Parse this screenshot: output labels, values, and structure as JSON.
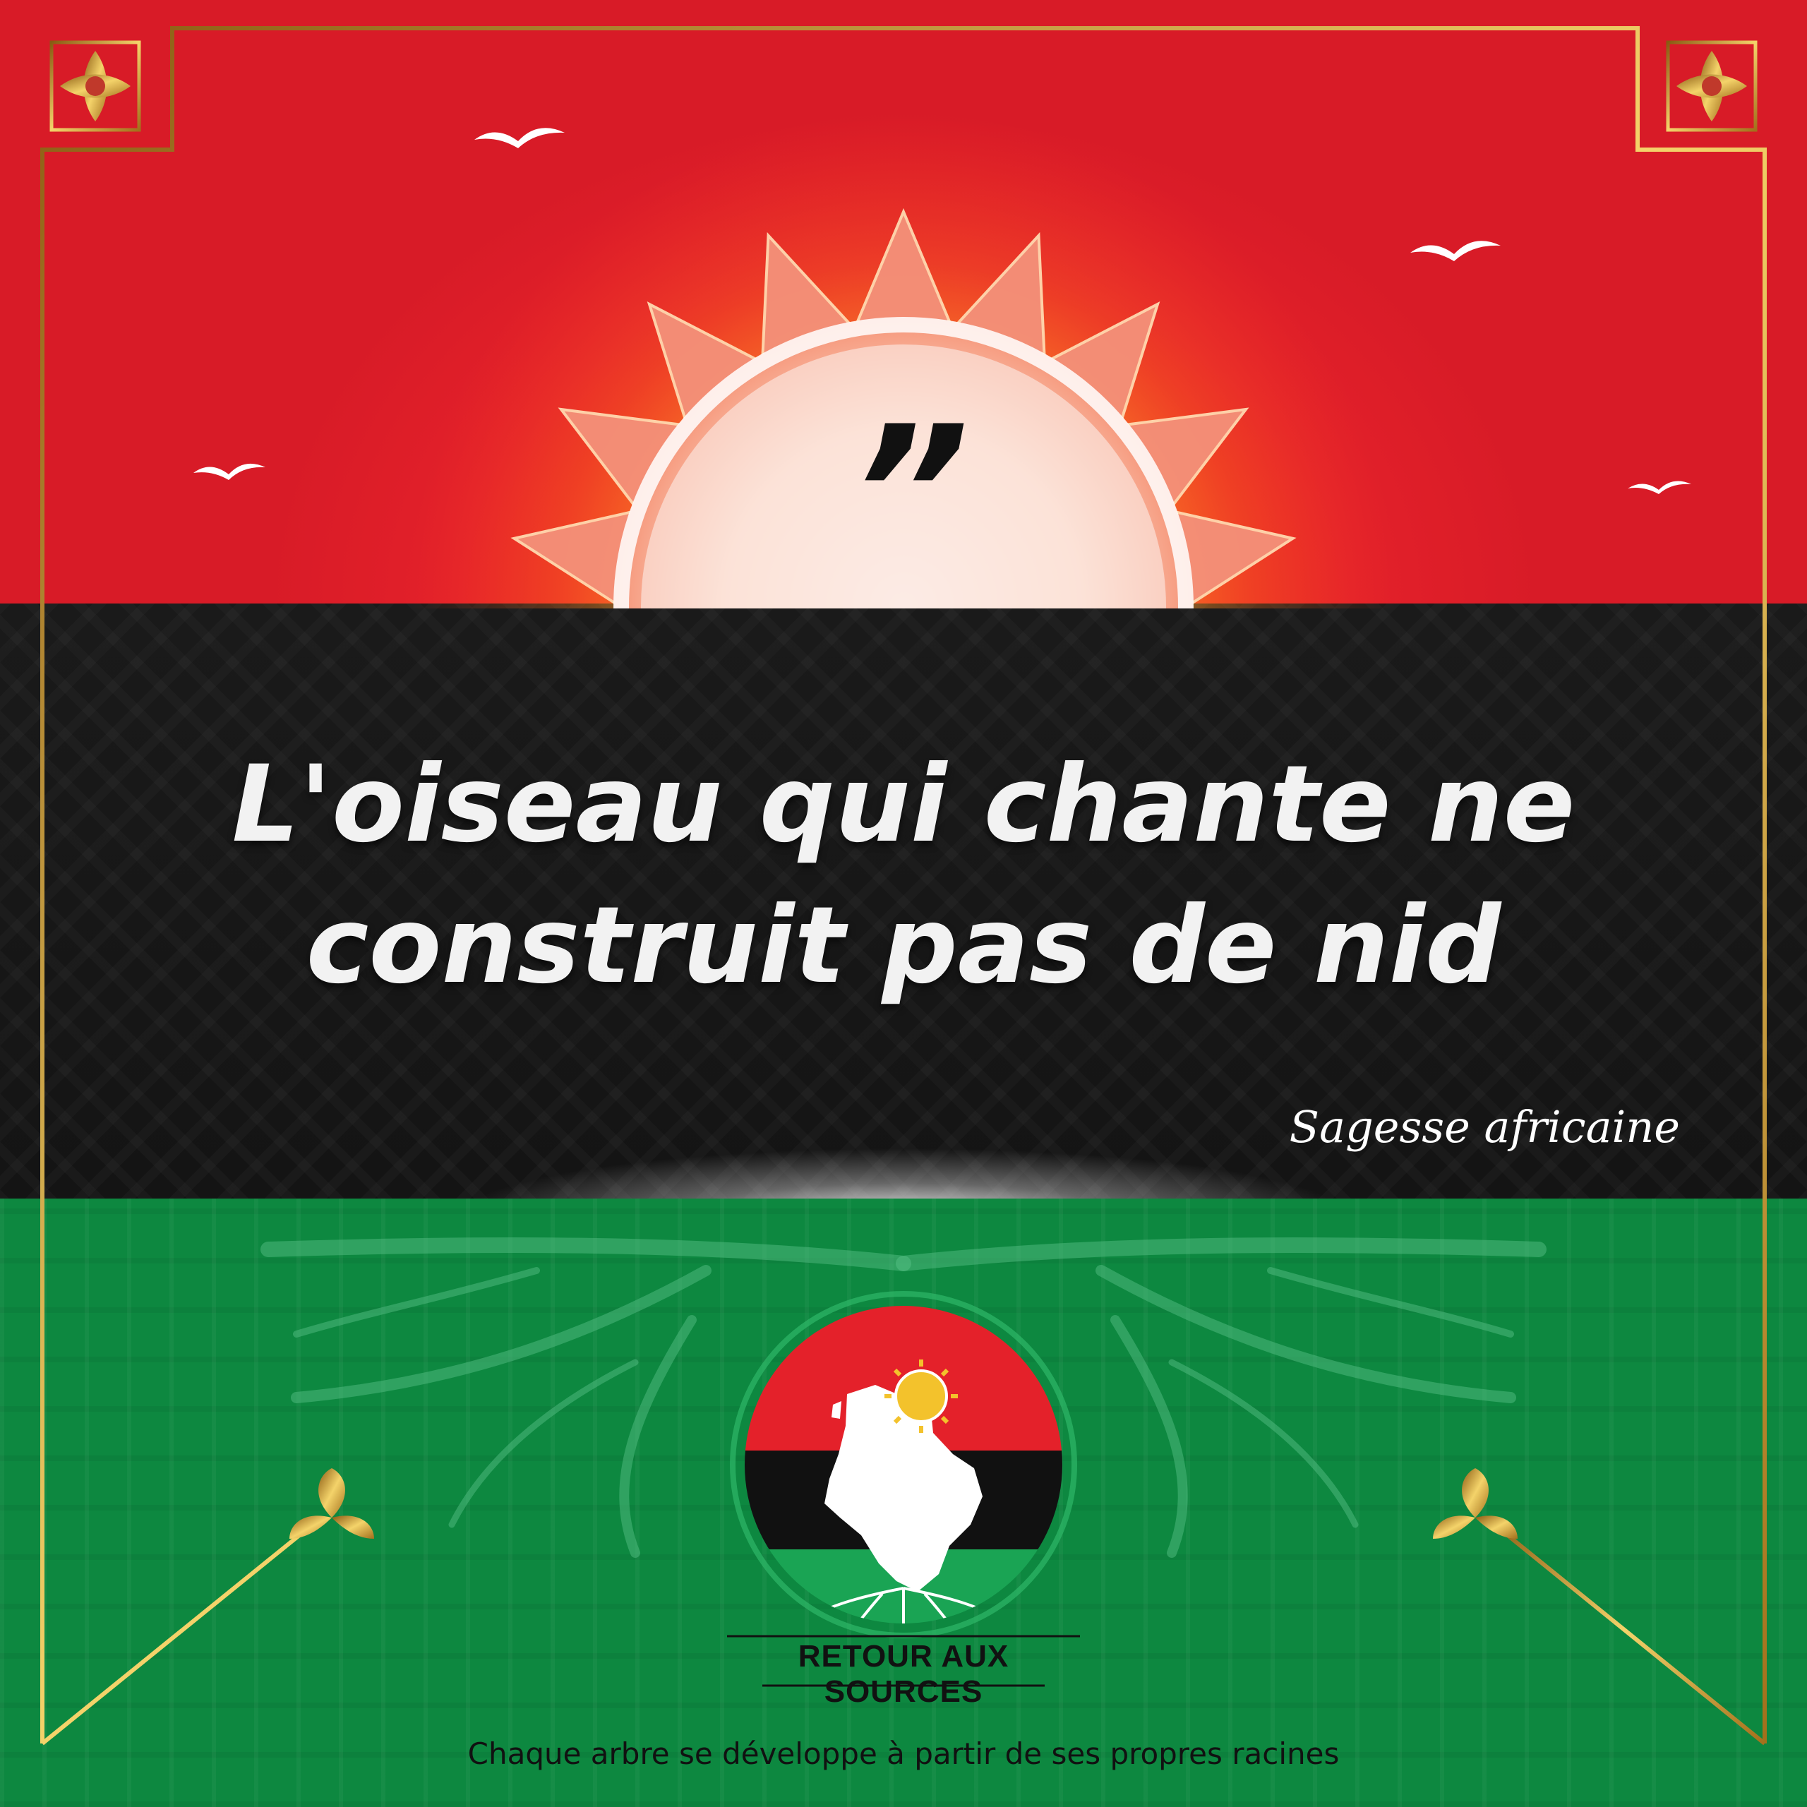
{
  "quote": {
    "mark": "”",
    "lines": [
      "L'oiseau qui chante ne",
      "construit pas de nid"
    ]
  },
  "attribution": "Sagesse africaine",
  "logo": {
    "caption": "RETOUR AUX SOURCES"
  },
  "tagline": "Chaque arbre se développe à partir de ses propres racines",
  "colors": {
    "red": "#e4212a",
    "black": "#161616",
    "green": "#12954a",
    "gold": "#d4a73c",
    "sun": "#f3c22c"
  },
  "icons": [
    "sun-icon",
    "bird-icon",
    "ornament-icon",
    "africa-map-icon",
    "roots-icon",
    "leaf-sprig-icon"
  ]
}
